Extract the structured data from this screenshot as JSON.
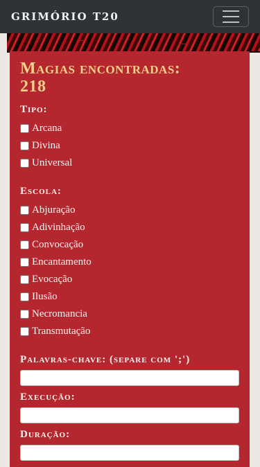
{
  "navbar": {
    "brand": "GRIMÓRIO T20",
    "toggle_icon": "hamburger-icon"
  },
  "panel": {
    "title_line1": "Magias encontradas:",
    "count": "218",
    "tipo": {
      "label": "Tipo:",
      "options": [
        "Arcana",
        "Divina",
        "Universal"
      ]
    },
    "escola": {
      "label": "Escola:",
      "options": [
        "Abjuração",
        "Adivinhação",
        "Convocação",
        "Encantamento",
        "Evocação",
        "Ilusão",
        "Necromancia",
        "Transmutação"
      ]
    },
    "keywords": {
      "label": "Palavras-chave: (separe com ';')",
      "value": ""
    },
    "execucao": {
      "label": "Execução:",
      "value": ""
    },
    "duracao": {
      "label": "Duração:",
      "value": ""
    }
  },
  "colors": {
    "navbar": "#2f3236",
    "panel": "#b5272f",
    "title": "#f3cf8a"
  }
}
